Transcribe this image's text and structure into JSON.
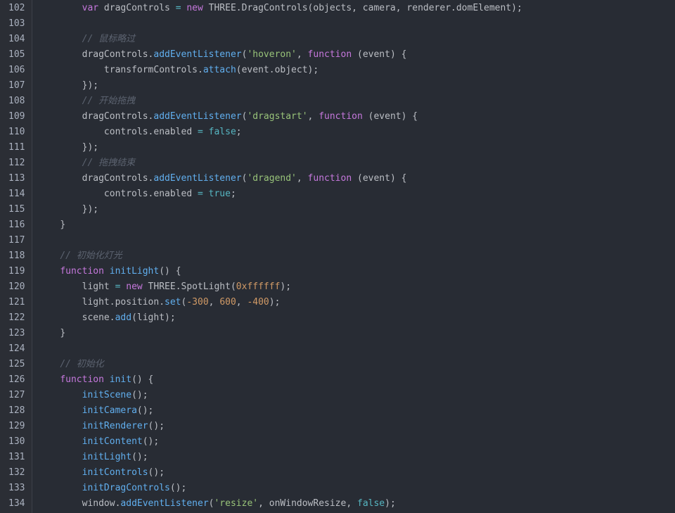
{
  "colors": {
    "background": "#282c34",
    "gutter_background": "#2b2e35",
    "line_number": "#aab1bf",
    "keyword": "#c678dd",
    "identifier": "#bbbec4",
    "function": "#61afef",
    "string": "#98c379",
    "number": "#d19a66",
    "boolean": "#56b6c2",
    "comment": "#5c6370"
  },
  "lines": [
    {
      "num": "102",
      "indent": "        ",
      "tokens": [
        {
          "t": "var",
          "c": "keyword"
        },
        {
          "t": " dragControls ",
          "c": "ident"
        },
        {
          "t": "=",
          "c": "op"
        },
        {
          "t": " ",
          "c": "ident"
        },
        {
          "t": "new",
          "c": "keyword"
        },
        {
          "t": " THREE.DragControls(objects, camera, renderer.domElement);",
          "c": "ident"
        }
      ]
    },
    {
      "num": "103",
      "indent": "",
      "tokens": []
    },
    {
      "num": "104",
      "indent": "        ",
      "tokens": [
        {
          "t": "// 鼠标略过",
          "c": "comment"
        }
      ]
    },
    {
      "num": "105",
      "indent": "        ",
      "tokens": [
        {
          "t": "dragControls.",
          "c": "ident"
        },
        {
          "t": "addEventListener",
          "c": "fn"
        },
        {
          "t": "(",
          "c": "ident"
        },
        {
          "t": "'hoveron'",
          "c": "string"
        },
        {
          "t": ", ",
          "c": "ident"
        },
        {
          "t": "function",
          "c": "keyword"
        },
        {
          "t": " (event) {",
          "c": "ident"
        }
      ]
    },
    {
      "num": "106",
      "indent": "            ",
      "tokens": [
        {
          "t": "transformControls.",
          "c": "ident"
        },
        {
          "t": "attach",
          "c": "fn"
        },
        {
          "t": "(event.object);",
          "c": "ident"
        }
      ]
    },
    {
      "num": "107",
      "indent": "        ",
      "tokens": [
        {
          "t": "});",
          "c": "ident"
        }
      ]
    },
    {
      "num": "108",
      "indent": "        ",
      "tokens": [
        {
          "t": "// 开始拖拽",
          "c": "comment"
        }
      ]
    },
    {
      "num": "109",
      "indent": "        ",
      "tokens": [
        {
          "t": "dragControls.",
          "c": "ident"
        },
        {
          "t": "addEventListener",
          "c": "fn"
        },
        {
          "t": "(",
          "c": "ident"
        },
        {
          "t": "'dragstart'",
          "c": "string"
        },
        {
          "t": ", ",
          "c": "ident"
        },
        {
          "t": "function",
          "c": "keyword"
        },
        {
          "t": " (event) {",
          "c": "ident"
        }
      ]
    },
    {
      "num": "110",
      "indent": "            ",
      "tokens": [
        {
          "t": "controls.enabled ",
          "c": "ident"
        },
        {
          "t": "=",
          "c": "op"
        },
        {
          "t": " ",
          "c": "ident"
        },
        {
          "t": "false",
          "c": "bool"
        },
        {
          "t": ";",
          "c": "ident"
        }
      ]
    },
    {
      "num": "111",
      "indent": "        ",
      "tokens": [
        {
          "t": "});",
          "c": "ident"
        }
      ]
    },
    {
      "num": "112",
      "indent": "        ",
      "tokens": [
        {
          "t": "// 拖拽结束",
          "c": "comment"
        }
      ]
    },
    {
      "num": "113",
      "indent": "        ",
      "tokens": [
        {
          "t": "dragControls.",
          "c": "ident"
        },
        {
          "t": "addEventListener",
          "c": "fn"
        },
        {
          "t": "(",
          "c": "ident"
        },
        {
          "t": "'dragend'",
          "c": "string"
        },
        {
          "t": ", ",
          "c": "ident"
        },
        {
          "t": "function",
          "c": "keyword"
        },
        {
          "t": " (event) {",
          "c": "ident"
        }
      ]
    },
    {
      "num": "114",
      "indent": "            ",
      "tokens": [
        {
          "t": "controls.enabled ",
          "c": "ident"
        },
        {
          "t": "=",
          "c": "op"
        },
        {
          "t": " ",
          "c": "ident"
        },
        {
          "t": "true",
          "c": "bool"
        },
        {
          "t": ";",
          "c": "ident"
        }
      ]
    },
    {
      "num": "115",
      "indent": "        ",
      "tokens": [
        {
          "t": "});",
          "c": "ident"
        }
      ]
    },
    {
      "num": "116",
      "indent": "    ",
      "tokens": [
        {
          "t": "}",
          "c": "ident"
        }
      ]
    },
    {
      "num": "117",
      "indent": "",
      "tokens": []
    },
    {
      "num": "118",
      "indent": "    ",
      "tokens": [
        {
          "t": "// 初始化灯光",
          "c": "comment"
        }
      ]
    },
    {
      "num": "119",
      "indent": "    ",
      "tokens": [
        {
          "t": "function",
          "c": "keyword"
        },
        {
          "t": " ",
          "c": "ident"
        },
        {
          "t": "initLight",
          "c": "fn"
        },
        {
          "t": "() {",
          "c": "ident"
        }
      ]
    },
    {
      "num": "120",
      "indent": "        ",
      "tokens": [
        {
          "t": "light ",
          "c": "ident"
        },
        {
          "t": "=",
          "c": "op"
        },
        {
          "t": " ",
          "c": "ident"
        },
        {
          "t": "new",
          "c": "keyword"
        },
        {
          "t": " THREE.SpotLight(",
          "c": "ident"
        },
        {
          "t": "0xffffff",
          "c": "number"
        },
        {
          "t": ");",
          "c": "ident"
        }
      ]
    },
    {
      "num": "121",
      "indent": "        ",
      "tokens": [
        {
          "t": "light.position.",
          "c": "ident"
        },
        {
          "t": "set",
          "c": "fn"
        },
        {
          "t": "(",
          "c": "ident"
        },
        {
          "t": "-300",
          "c": "number"
        },
        {
          "t": ", ",
          "c": "ident"
        },
        {
          "t": "600",
          "c": "number"
        },
        {
          "t": ", ",
          "c": "ident"
        },
        {
          "t": "-400",
          "c": "number"
        },
        {
          "t": ");",
          "c": "ident"
        }
      ]
    },
    {
      "num": "122",
      "indent": "        ",
      "tokens": [
        {
          "t": "scene.",
          "c": "ident"
        },
        {
          "t": "add",
          "c": "fn"
        },
        {
          "t": "(light);",
          "c": "ident"
        }
      ]
    },
    {
      "num": "123",
      "indent": "    ",
      "tokens": [
        {
          "t": "}",
          "c": "ident"
        }
      ]
    },
    {
      "num": "124",
      "indent": "",
      "tokens": []
    },
    {
      "num": "125",
      "indent": "    ",
      "tokens": [
        {
          "t": "// 初始化",
          "c": "comment"
        }
      ]
    },
    {
      "num": "126",
      "indent": "    ",
      "tokens": [
        {
          "t": "function",
          "c": "keyword"
        },
        {
          "t": " ",
          "c": "ident"
        },
        {
          "t": "init",
          "c": "fn"
        },
        {
          "t": "() {",
          "c": "ident"
        }
      ]
    },
    {
      "num": "127",
      "indent": "        ",
      "tokens": [
        {
          "t": "initScene",
          "c": "fn"
        },
        {
          "t": "();",
          "c": "ident"
        }
      ]
    },
    {
      "num": "128",
      "indent": "        ",
      "tokens": [
        {
          "t": "initCamera",
          "c": "fn"
        },
        {
          "t": "();",
          "c": "ident"
        }
      ]
    },
    {
      "num": "129",
      "indent": "        ",
      "tokens": [
        {
          "t": "initRenderer",
          "c": "fn"
        },
        {
          "t": "();",
          "c": "ident"
        }
      ]
    },
    {
      "num": "130",
      "indent": "        ",
      "tokens": [
        {
          "t": "initContent",
          "c": "fn"
        },
        {
          "t": "();",
          "c": "ident"
        }
      ]
    },
    {
      "num": "131",
      "indent": "        ",
      "tokens": [
        {
          "t": "initLight",
          "c": "fn"
        },
        {
          "t": "();",
          "c": "ident"
        }
      ]
    },
    {
      "num": "132",
      "indent": "        ",
      "tokens": [
        {
          "t": "initControls",
          "c": "fn"
        },
        {
          "t": "();",
          "c": "ident"
        }
      ]
    },
    {
      "num": "133",
      "indent": "        ",
      "tokens": [
        {
          "t": "initDragControls",
          "c": "fn"
        },
        {
          "t": "();",
          "c": "ident"
        }
      ]
    },
    {
      "num": "134",
      "indent": "        ",
      "tokens": [
        {
          "t": "window.",
          "c": "ident"
        },
        {
          "t": "addEventListener",
          "c": "fn"
        },
        {
          "t": "(",
          "c": "ident"
        },
        {
          "t": "'resize'",
          "c": "string"
        },
        {
          "t": ", onWindowResize, ",
          "c": "ident"
        },
        {
          "t": "false",
          "c": "bool"
        },
        {
          "t": ");",
          "c": "ident"
        }
      ]
    }
  ]
}
